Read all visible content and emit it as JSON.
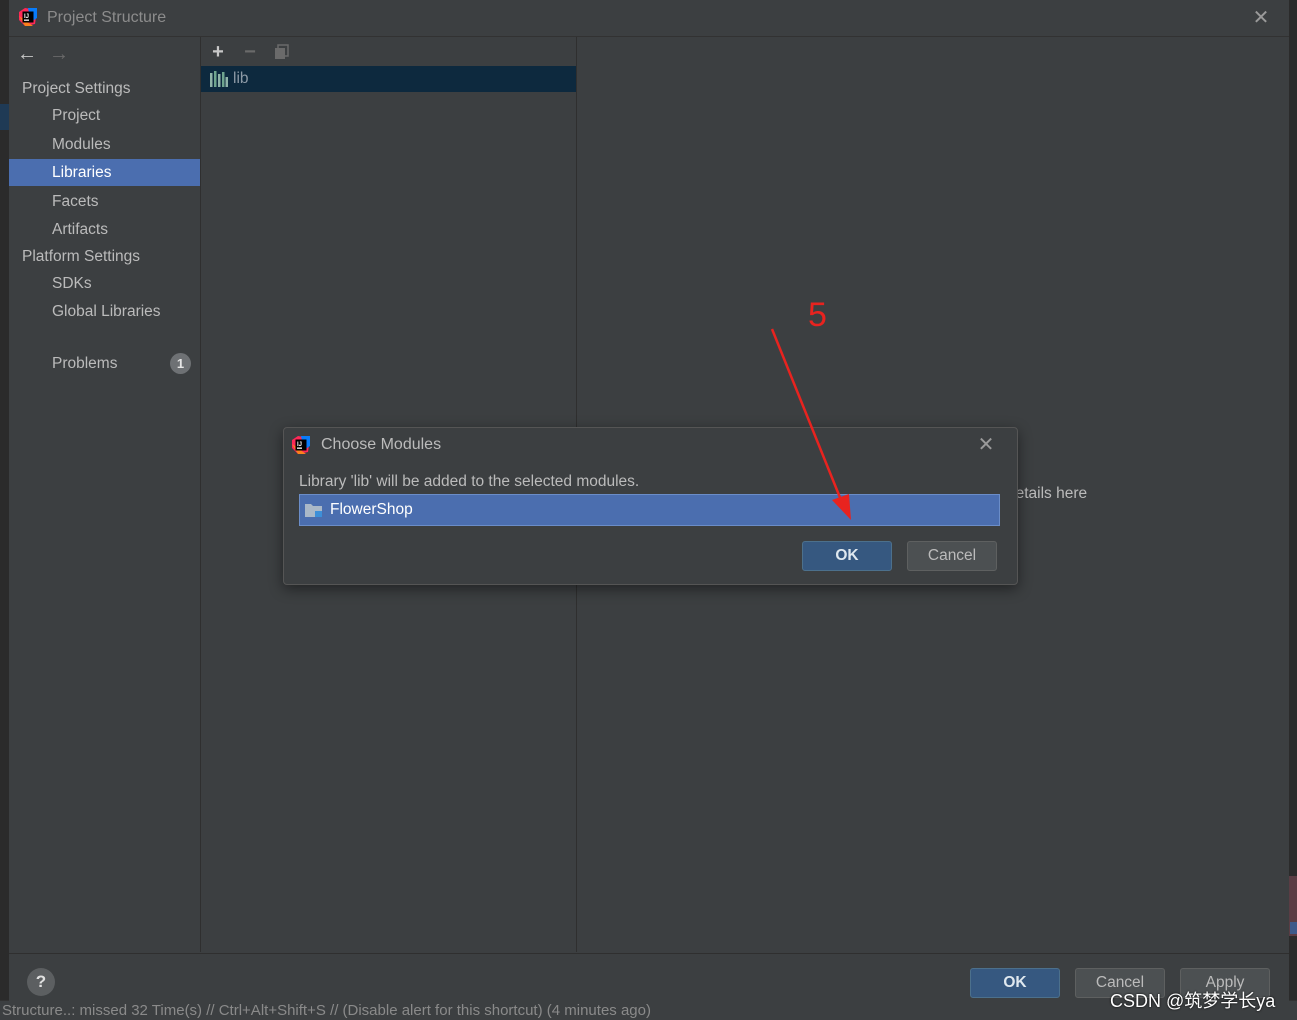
{
  "window": {
    "title": "Project Structure"
  },
  "nav": {
    "project_settings_header": "Project Settings",
    "project_items": [
      "Project",
      "Modules",
      "Libraries",
      "Facets",
      "Artifacts"
    ],
    "selected": "Libraries",
    "platform_settings_header": "Platform Settings",
    "platform_items": [
      "SDKs",
      "Global Libraries"
    ],
    "problems_label": "Problems",
    "problems_count": "1"
  },
  "libraries": {
    "items": [
      {
        "name": "lib"
      }
    ]
  },
  "details": {
    "hint_text": "details here"
  },
  "bottom": {
    "ok": "OK",
    "cancel": "Cancel",
    "apply": "Apply",
    "help": "?"
  },
  "choose_modules": {
    "title": "Choose Modules",
    "message": "Library 'lib' will be added to the selected modules.",
    "modules": [
      {
        "name": "FlowerShop"
      }
    ],
    "ok": "OK",
    "cancel": "Cancel"
  },
  "annotation": {
    "step_number": "5",
    "color": "#e8231f"
  },
  "status_bar": {
    "text": "Structure..: missed 32 Time(s) // Ctrl+Alt+Shift+S // (Disable alert for this shortcut) (4 minutes ago)"
  },
  "watermark": {
    "text": "CSDN @筑梦学长ya"
  },
  "colors": {
    "selection": "#4b6eaf",
    "panel_bg": "#3c3f41",
    "primary_button": "#365880"
  }
}
